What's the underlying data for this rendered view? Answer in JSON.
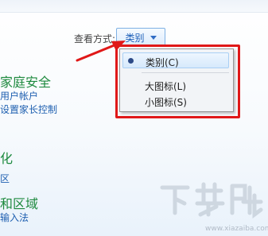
{
  "toolbar": {
    "view_by_label": "查看方式:",
    "view_by_value": "类别"
  },
  "view_menu": {
    "items": [
      {
        "label": "类别(C)",
        "selected": true
      },
      {
        "label": "大图标(L)",
        "selected": false
      },
      {
        "label": "小图标(S)",
        "selected": false
      }
    ]
  },
  "categories": [
    {
      "title": "家庭安全",
      "links": [
        "用户帐户",
        "设置家长控制"
      ]
    },
    {
      "title": "化",
      "links": []
    },
    {
      "title": "",
      "links": [
        "区"
      ]
    },
    {
      "title": "和区域",
      "links": [
        "输入法"
      ]
    }
  ],
  "colors": {
    "annotation": "#e01818",
    "category_title": "#1e8a3f",
    "link": "#1e5fb0"
  },
  "watermark": {
    "text": "下载吧",
    "url": "www.xiazaiba.com"
  }
}
